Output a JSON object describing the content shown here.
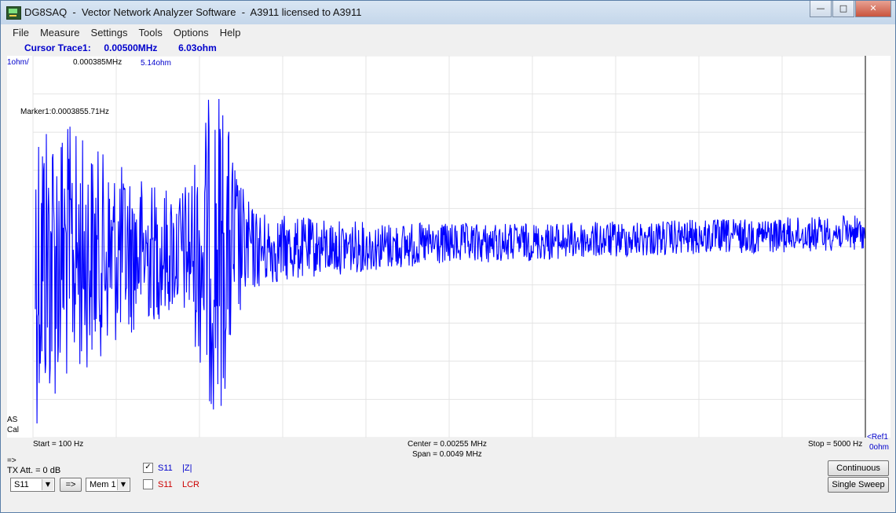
{
  "window": {
    "title": "DG8SAQ  -  Vector Network Analyzer Software  -  A3911 licensed to A3911"
  },
  "menu": [
    "File",
    "Measure",
    "Settings",
    "Tools",
    "Options",
    "Help"
  ],
  "cursor": {
    "label": "Cursor Trace1:",
    "freq": "0.00500MHz",
    "value": "6.03ohm"
  },
  "plot": {
    "scale_label": "1ohm/",
    "top_freq": "0.000385MHz",
    "top_value": "5.14ohm",
    "marker_label": "Marker1:",
    "marker_value": "0.000385",
    "marker_value2": "5.71",
    "marker_unit": "Hz",
    "as_label": "AS",
    "cal_label": "Cal",
    "start": "Start = 100 Hz",
    "center": "Center = 0.00255 MHz",
    "span": "Span = 0.0049 MHz",
    "stop": "Stop = 5000 Hz",
    "ref_label": "<Ref1",
    "ref_value": "0ohm",
    "trace_color": "#0000ff",
    "grid_color": "#e4e4e4"
  },
  "controls": {
    "arrow_label": "=>",
    "tx_att": "TX Att.  = 0 dB",
    "s11_select": "S11",
    "arrow_button": "=>",
    "mem_select": "Mem 1",
    "trace1_param": "S11",
    "trace1_mode": "|Z|",
    "trace2_param": "S11",
    "trace2_mode": "LCR",
    "check_mark": "✓",
    "continuous": "Continuous",
    "single_sweep": "Single Sweep"
  }
}
